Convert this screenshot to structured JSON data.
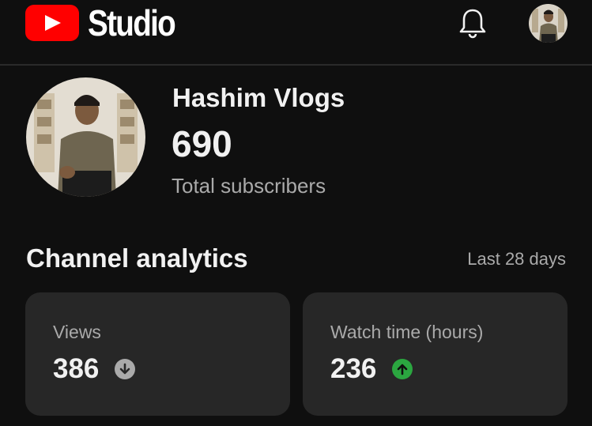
{
  "header": {
    "app_name": "Studio",
    "notifications_icon": "bell-icon",
    "account_icon": "avatar"
  },
  "channel": {
    "name": "Hashim Vlogs",
    "subscriber_count": "690",
    "subscriber_label": "Total subscribers"
  },
  "analytics": {
    "title": "Channel analytics",
    "range": "Last 28 days",
    "cards": [
      {
        "label": "Views",
        "value": "386",
        "trend": "down",
        "trend_icon": "arrow-down-circle-icon",
        "trend_color": "#aaaaaa"
      },
      {
        "label": "Watch time (hours)",
        "value": "236",
        "trend": "up",
        "trend_icon": "arrow-up-circle-icon",
        "trend_color": "#2ba640"
      }
    ]
  },
  "colors": {
    "background": "#0f0f0f",
    "card": "#272727",
    "brand_red": "#ff0000",
    "secondary_text": "#aaaaaa"
  }
}
